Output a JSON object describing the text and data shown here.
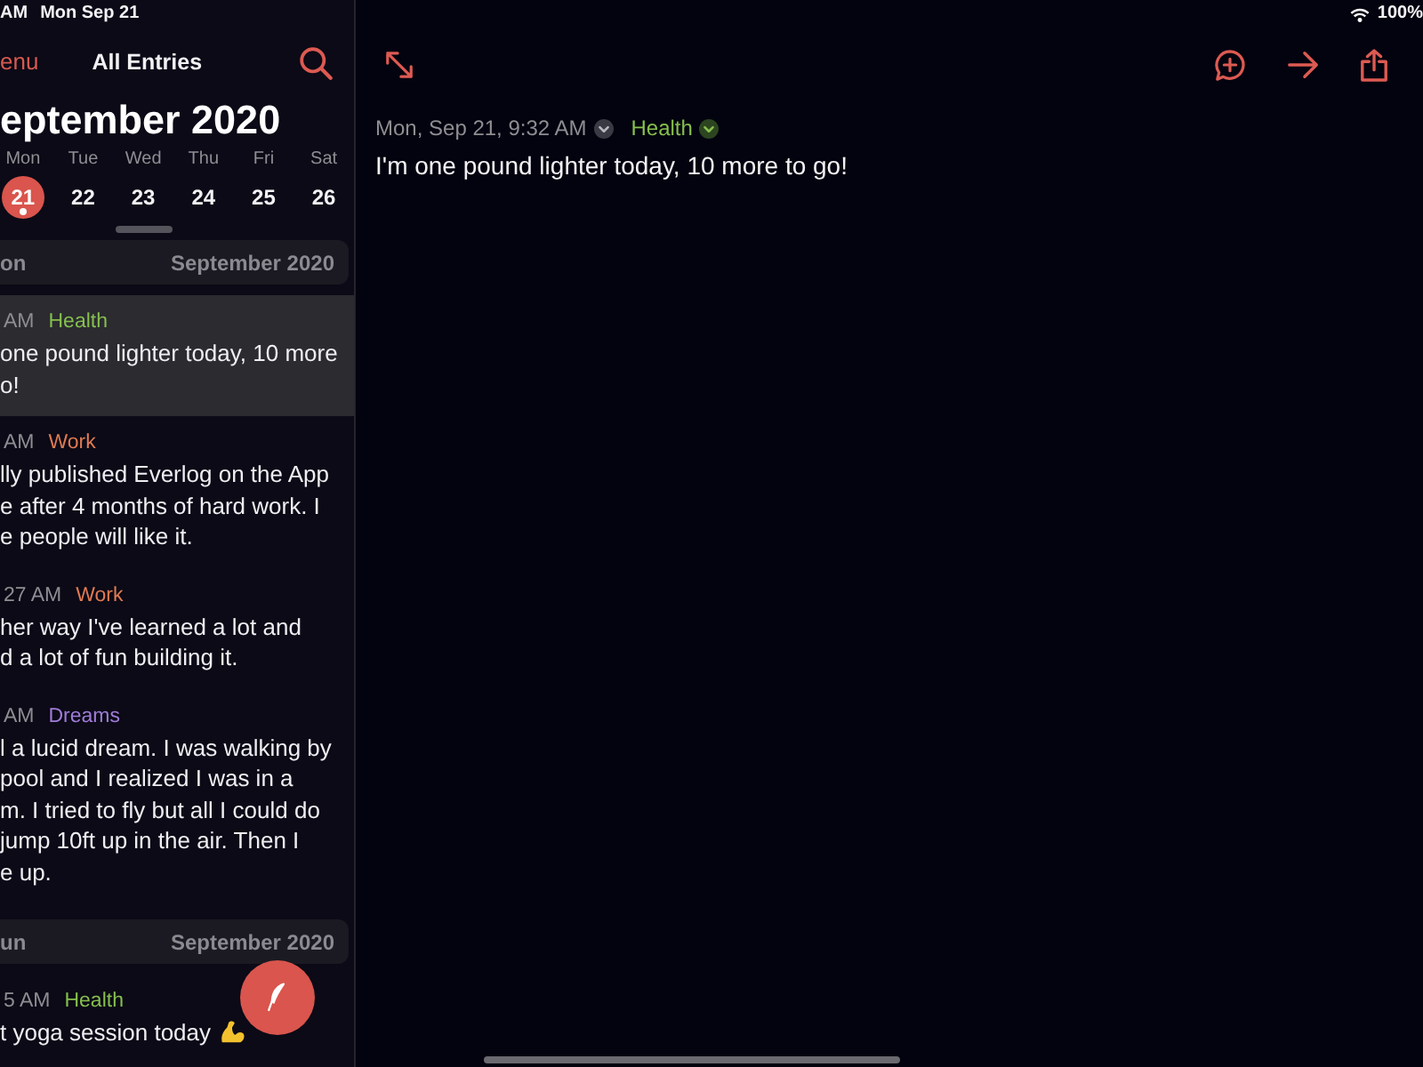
{
  "status_bar": {
    "time": "AM",
    "date": "Mon Sep 21",
    "battery": "100%"
  },
  "sidebar": {
    "menu_button": "enu",
    "title": "All Entries",
    "month": "eptember 2020",
    "days": [
      {
        "weekday": "Mon",
        "date": "21",
        "selected": true,
        "has_entry": true
      },
      {
        "weekday": "Tue",
        "date": "22",
        "selected": false,
        "has_entry": false
      },
      {
        "weekday": "Wed",
        "date": "23",
        "selected": false,
        "has_entry": false
      },
      {
        "weekday": "Thu",
        "date": "24",
        "selected": false,
        "has_entry": false
      },
      {
        "weekday": "Fri",
        "date": "25",
        "selected": false,
        "has_entry": false
      },
      {
        "weekday": "Sat",
        "date": "26",
        "selected": false,
        "has_entry": false
      }
    ],
    "sections": [
      {
        "day": "on",
        "month": "September 2020",
        "entries": [
          {
            "time": "AM",
            "tag": "Health",
            "color": "#86bf4e",
            "text": "one pound lighter today, 10 more\no!",
            "emoji": false,
            "selected": true
          },
          {
            "time": "AM",
            "tag": "Work",
            "color": "#e07a52",
            "text": "lly published Everlog on the App\ne after 4 months of hard work. I\ne people will like it.",
            "emoji": false,
            "selected": false
          },
          {
            "time": "27 AM",
            "tag": "Work",
            "color": "#e07a52",
            "text": "her way I've learned a lot and\nd a lot of fun building it.",
            "emoji": false,
            "selected": false
          },
          {
            "time": "AM",
            "tag": "Dreams",
            "color": "#a07cd8",
            "text": "l a lucid dream. I was walking by\npool and I realized I was in a\nm. I tried to fly but all I could do\njump 10ft up in the air. Then I\ne up.",
            "emoji": false,
            "selected": false
          }
        ]
      },
      {
        "day": "un",
        "month": "September 2020",
        "entries": [
          {
            "time": "5 AM",
            "tag": "Health",
            "color": "#86bf4e",
            "text": "t yoga session today",
            "emoji": true,
            "selected": false
          }
        ]
      }
    ]
  },
  "detail": {
    "date": "Mon, Sep 21, 9:32 AM",
    "tag": {
      "label": "Health",
      "color": "#86bf4e"
    },
    "text": "I'm one pound lighter today, 10 more to go!"
  }
}
